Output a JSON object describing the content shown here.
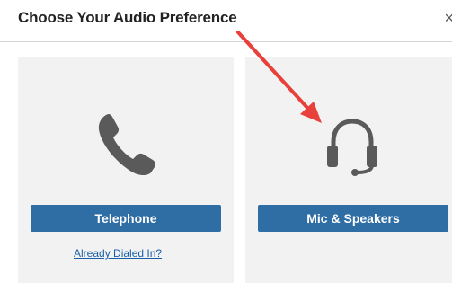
{
  "dialog": {
    "title": "Choose Your Audio Preference",
    "close_symbol": "×"
  },
  "options": [
    {
      "icon": "telephone-icon",
      "button_label": "Telephone",
      "link_label": "Already Dialed In?"
    },
    {
      "icon": "headset-icon",
      "button_label": "Mic & Speakers"
    }
  ],
  "colors": {
    "button": "#2f6ea5",
    "card": "#f2f2f2",
    "icon": "#5a5a5a",
    "annotation_arrow": "#e8403a"
  }
}
